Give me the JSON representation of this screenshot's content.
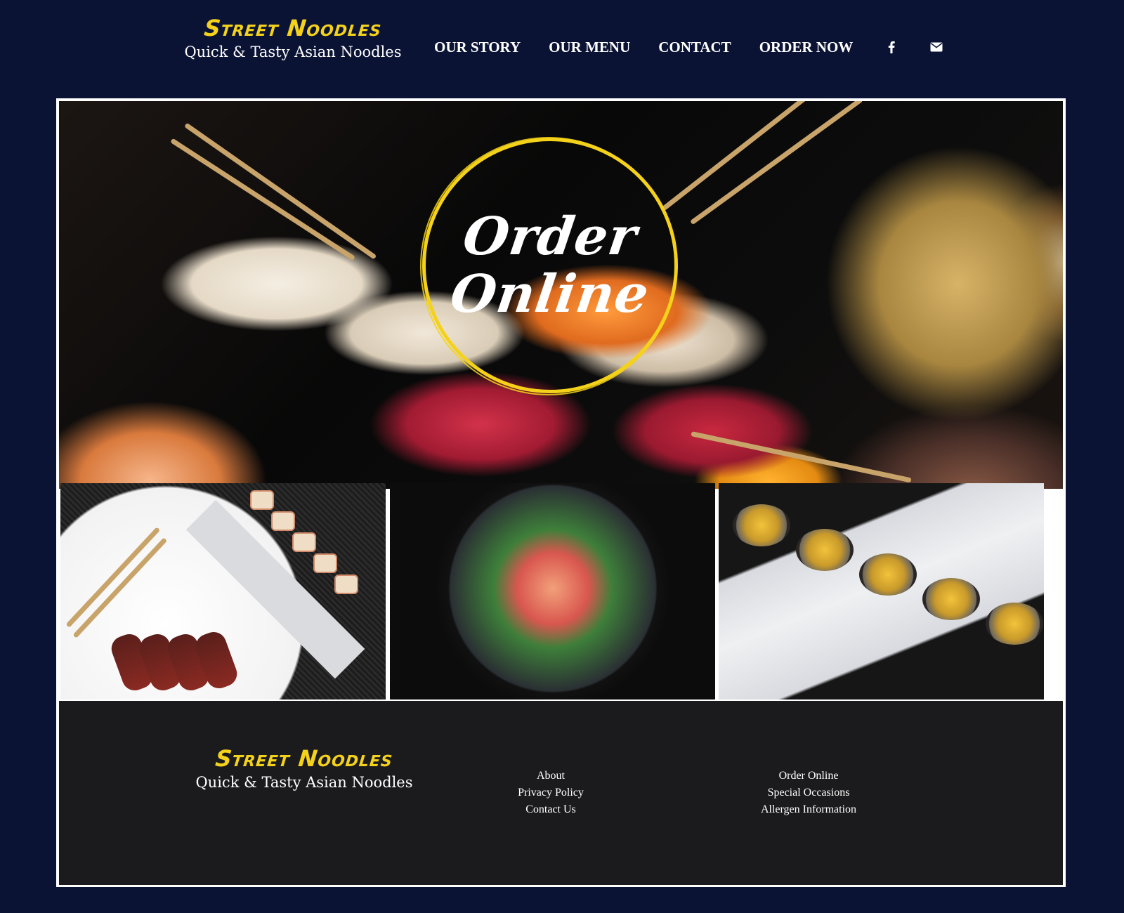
{
  "header": {
    "brand_title": "Street Noodles",
    "brand_subtitle": "Quick & Tasty Asian Noodles",
    "nav": [
      {
        "label": "OUR STORY"
      },
      {
        "label": "OUR MENU"
      },
      {
        "label": "CONTACT"
      },
      {
        "label": "ORDER NOW"
      }
    ],
    "social": [
      "facebook-icon",
      "envelope-icon"
    ]
  },
  "hero": {
    "line1": "Order",
    "line2": "Online"
  },
  "gallery": [
    "seared tuna plate",
    "sashimi bowl",
    "fried oysters"
  ],
  "footer": {
    "brand_title": "Street Noodles",
    "brand_subtitle": "Quick & Tasty Asian Noodles",
    "links_left": [
      "About",
      "Privacy Policy",
      "Contact Us"
    ],
    "links_right": [
      "Order Online",
      "Special Occasions",
      "Allergen Information"
    ]
  },
  "colors": {
    "page_bg": "#0b1335",
    "accent_yellow": "#f5d21a",
    "footer_bg": "#1b1b1d"
  }
}
